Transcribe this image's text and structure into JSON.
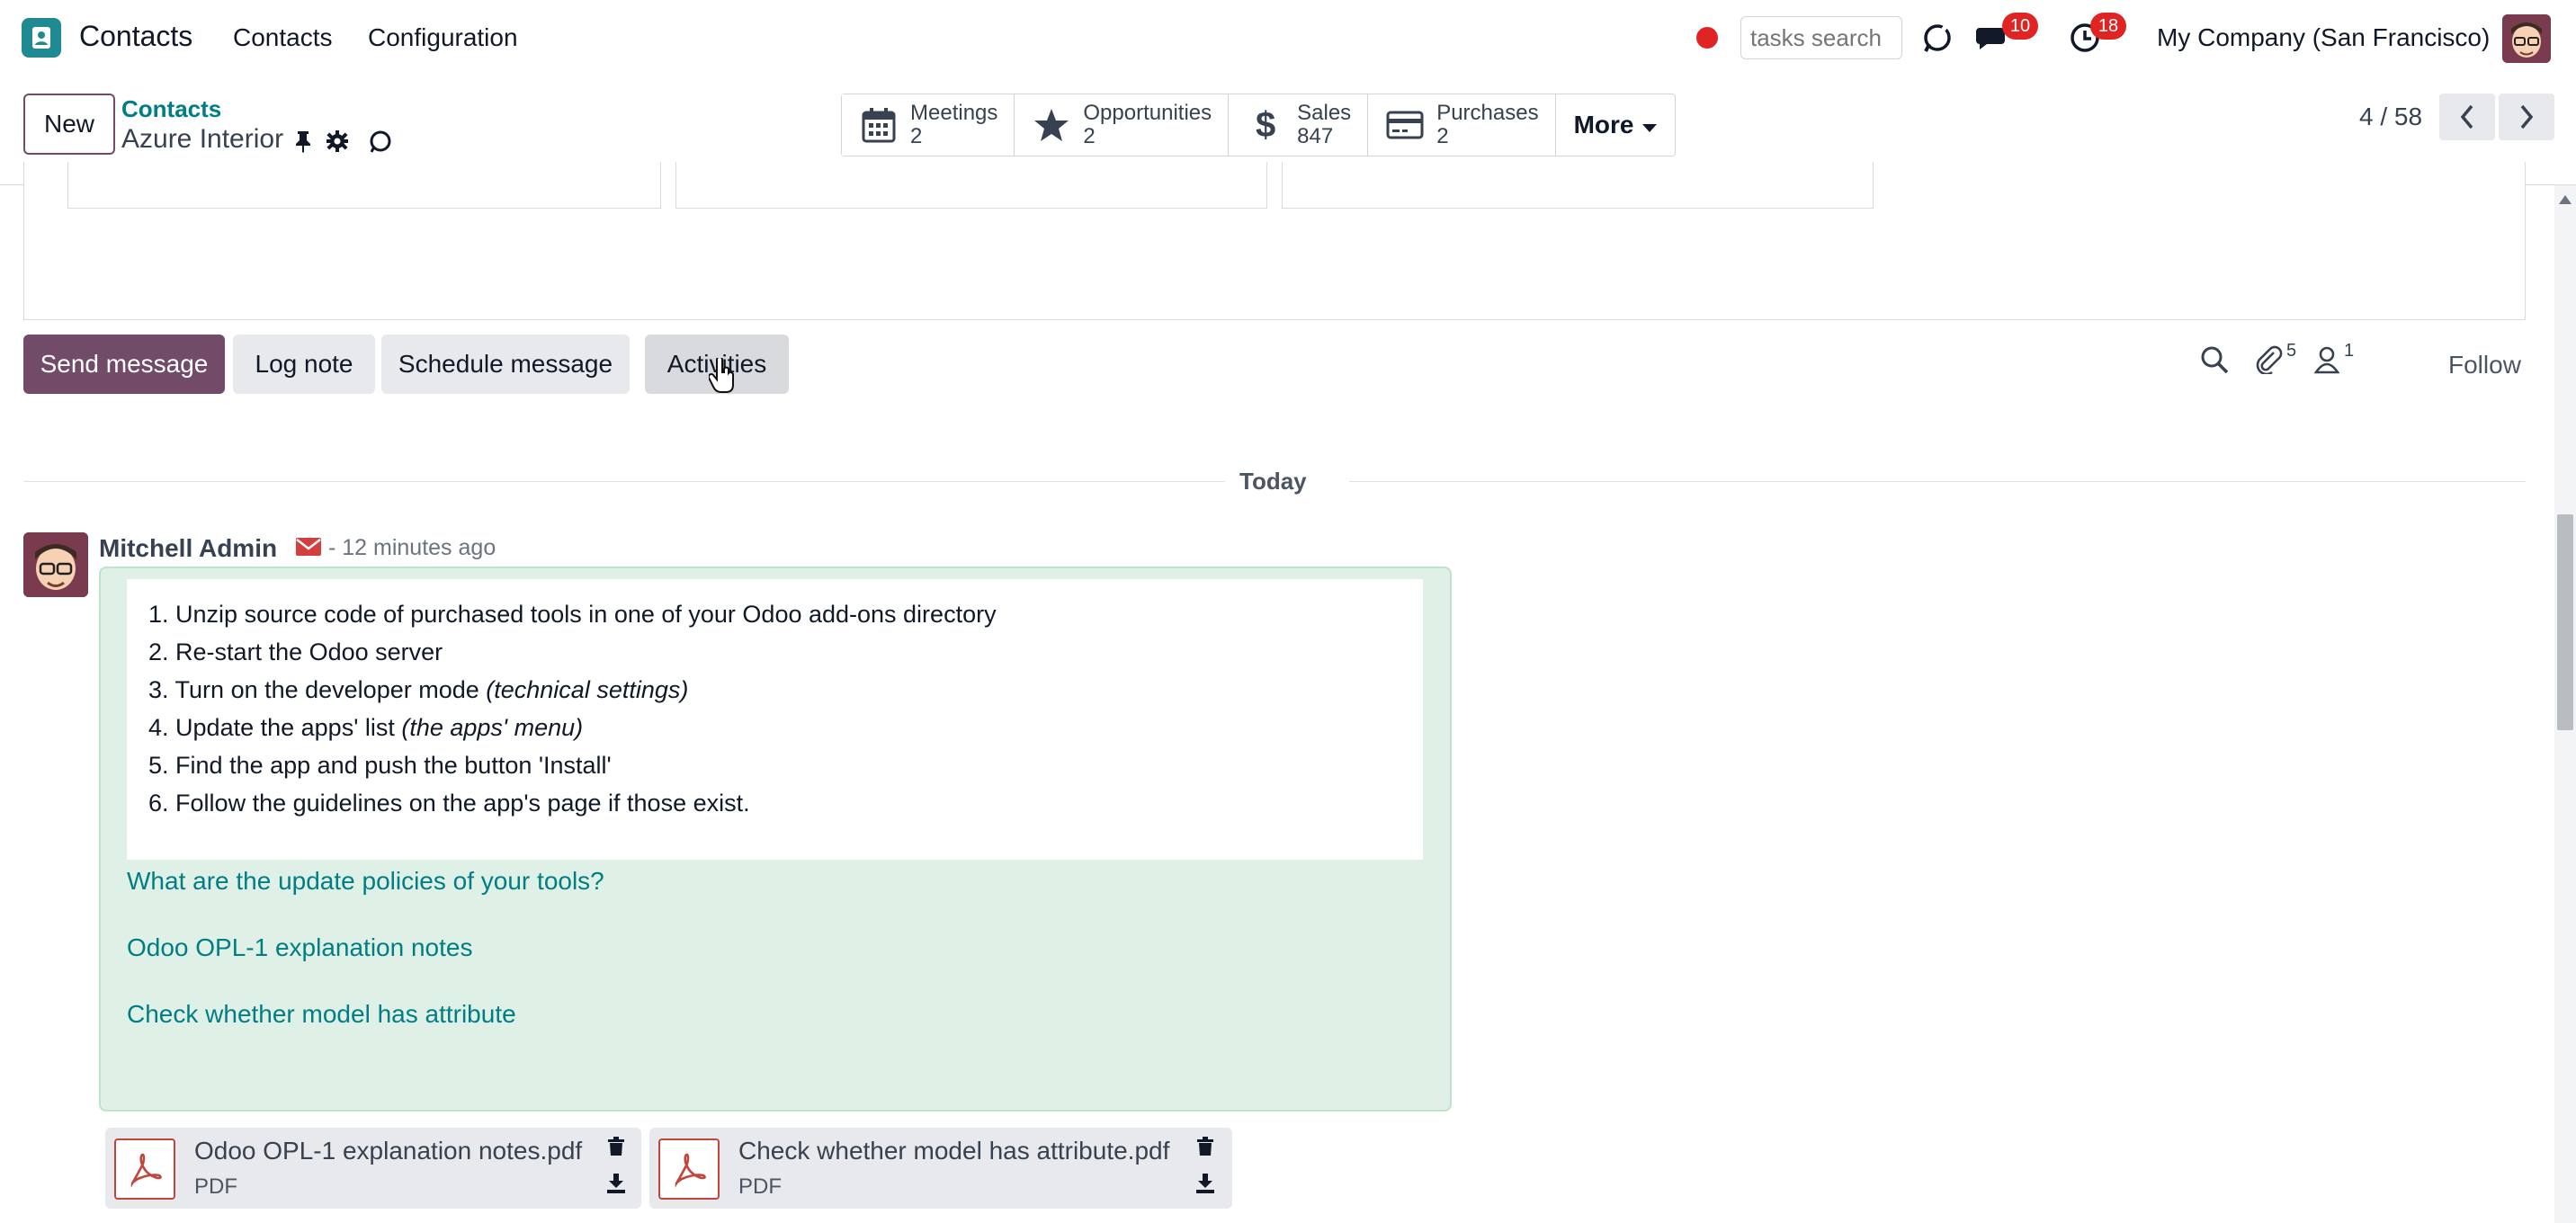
{
  "topnav": {
    "app_name": "Contacts",
    "menu": [
      "Contacts",
      "Configuration"
    ],
    "search_placeholder": "tasks search",
    "messages_badge": "10",
    "activities_badge": "18",
    "company": "My Company (San Francisco)"
  },
  "control": {
    "new_label": "New",
    "breadcrumb_parent": "Contacts",
    "breadcrumb_current": "Azure Interior",
    "smart_buttons": [
      {
        "label": "Meetings",
        "value": "2",
        "icon": "calendar-icon"
      },
      {
        "label": "Opportunities",
        "value": "2",
        "icon": "star-icon"
      },
      {
        "label": "Sales",
        "value": "847",
        "icon": "dollar-icon"
      },
      {
        "label": "Purchases",
        "value": "2",
        "icon": "credit-card-icon"
      }
    ],
    "more_label": "More",
    "pager": "4 / 58"
  },
  "chatter": {
    "send_message": "Send message",
    "log_note": "Log note",
    "schedule_message": "Schedule message",
    "activities": "Activities",
    "attachments_count": "5",
    "followers_count": "1",
    "follow": "Follow",
    "date_separator": "Today"
  },
  "message": {
    "author": "Mitchell Admin",
    "time": "- 12 minutes ago",
    "steps": [
      {
        "num": "1.",
        "text": "Unzip source code of purchased tools in one of your Odoo add-ons directory",
        "em": ""
      },
      {
        "num": "2.",
        "text": "Re-start the Odoo server",
        "em": ""
      },
      {
        "num": "3.",
        "text": "Turn on the developer mode ",
        "em": "(technical settings)"
      },
      {
        "num": "4.",
        "text": "Update the apps' list ",
        "em": "(the apps' menu)"
      },
      {
        "num": "5.",
        "text": "Find the app and push the button 'Install'",
        "em": ""
      },
      {
        "num": "6.",
        "text": "Follow the guidelines on the app's page if those exist.",
        "em": ""
      }
    ],
    "links": [
      "What are the update policies of your tools?",
      "Odoo OPL-1 explanation notes",
      "Check whether model has attribute"
    ]
  },
  "attachments": [
    {
      "name": "Odoo OPL-1 explanation notes.pdf",
      "type": "PDF"
    },
    {
      "name": "Check whether model has attribute.pdf",
      "type": "PDF"
    }
  ],
  "colors": {
    "brand": "#714b67",
    "link": "#017e84",
    "badge": "#e02424",
    "bubble": "#dff0e6"
  }
}
